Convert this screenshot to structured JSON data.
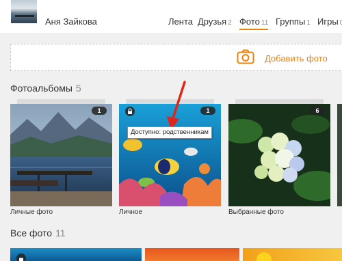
{
  "profile": {
    "name": "Аня Зайкова"
  },
  "nav": {
    "items": [
      {
        "label": "Лента",
        "count": ""
      },
      {
        "label": "Друзья",
        "count": "2"
      },
      {
        "label": "Фото",
        "count": "11",
        "active": true
      },
      {
        "label": "Группы",
        "count": "1"
      },
      {
        "label": "Игры",
        "count": "0"
      }
    ]
  },
  "add_photo": {
    "label": "Добавить фото",
    "icon": "camera-icon"
  },
  "albums_section": {
    "title": "Фотоальбомы",
    "count": "5",
    "albums": [
      {
        "name": "Личные фото",
        "count": "1"
      },
      {
        "name": "Личное",
        "count": "1",
        "locked": true,
        "tooltip": "Доступно: родственникам"
      },
      {
        "name": "Выбранные фото",
        "count": "6"
      },
      {
        "name": "",
        "count": ""
      }
    ]
  },
  "all_photos_section": {
    "title": "Все фото",
    "count": "11"
  },
  "colors": {
    "accent": "#ee8208",
    "arrow": "#e0251b"
  }
}
